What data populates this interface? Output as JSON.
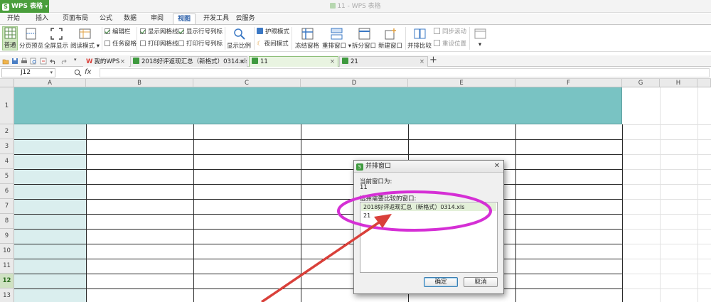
{
  "app": {
    "name": "WPS 表格",
    "window_title": "11 - WPS 表格"
  },
  "ribbon_tabs": [
    "开始",
    "插入",
    "页面布局",
    "公式",
    "数据",
    "审阅",
    "视图",
    "开发工具",
    "云服务"
  ],
  "active_tab": "视图",
  "ribbon": {
    "normal": "普通",
    "page_break": "分页预览",
    "fullscreen": "全屏显示",
    "reading_mode": "阅读模式",
    "edit_bar": "编辑栏",
    "task_pane": "任务窗格",
    "show_gridlines": "显示网格线",
    "print_gridlines": "打印网格线",
    "show_headers": "显示行号列标",
    "print_headers": "打印行号列标",
    "zoom": "显示比例",
    "eye_care": "护眼模式",
    "night_mode": "夜间模式",
    "freeze": "冻结窗格",
    "rearrange": "重排窗口",
    "split": "拆分窗口",
    "new_window": "新建窗口",
    "side_by_side": "并排比较",
    "sync_scroll": "同步滚动",
    "reset_position": "重设位置"
  },
  "doc_tabs": [
    {
      "label": "我的WPS"
    },
    {
      "label": "2018好评返现汇总（新格式）0314.xls *"
    },
    {
      "label": "11"
    },
    {
      "label": "21"
    }
  ],
  "add_tab": "+",
  "formula_bar": {
    "cell_ref": "J12",
    "fx": "fx"
  },
  "columns": [
    "A",
    "B",
    "C",
    "D",
    "E",
    "F",
    "G",
    "H"
  ],
  "rows": [
    "1",
    "2",
    "3",
    "4",
    "5",
    "6",
    "7",
    "8",
    "9",
    "10",
    "11",
    "12",
    "13"
  ],
  "selected_row": "12",
  "dialog": {
    "title": "并排窗口",
    "current_label": "当前窗口为:",
    "current_value": "11",
    "choose_label": "选择需要比较的窗口:",
    "options": [
      "2018好评返现汇总（新格式）0314.xls",
      "21"
    ],
    "ok": "确定",
    "cancel": "取消"
  },
  "colors": {
    "brand_green": "#4a9e3c",
    "header_teal": "#79c3c3",
    "col_a_fill": "#daeeee",
    "annotation_magenta": "#d52fd5",
    "arrow_red": "#d9403a"
  }
}
